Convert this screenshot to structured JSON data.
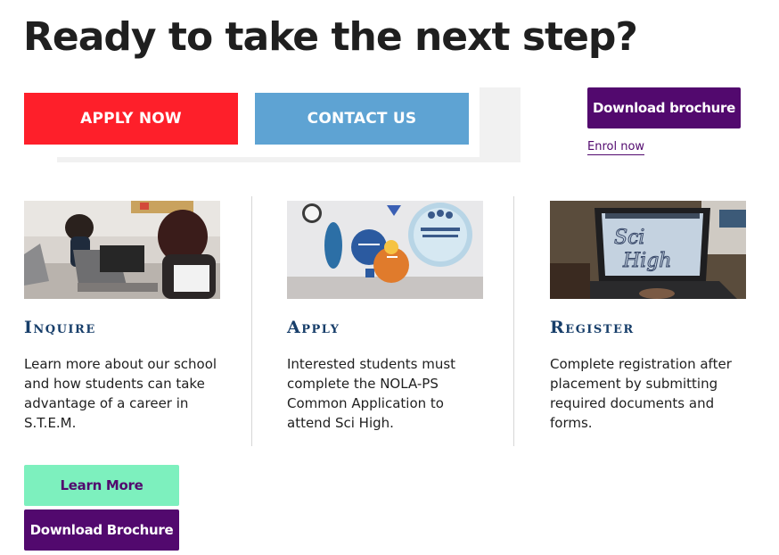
{
  "hero": {
    "headline": "Ready to take the next step?"
  },
  "cta": {
    "apply_label": "APPLY NOW",
    "apply_color": "#fe1f2a",
    "contact_label": "CONTACT US",
    "contact_color": "#5ea3d3",
    "download_label": "Download brochure",
    "enrol_label": "Enrol now"
  },
  "cards": [
    {
      "title": "Inquire",
      "text": "Learn more about our school and how students can take advantage of a career in S.T.E.M.",
      "image": "students-with-laptops-photo"
    },
    {
      "title": "Apply",
      "text": "Interested students must complete the NOLA-PS Common Application to attend Sci High.",
      "image": "values-wall-signs-photo"
    },
    {
      "title": "Register",
      "text": "Complete registration after placement by submitting required documents and forms.",
      "image": "laptop-sci-high-design-photo"
    }
  ],
  "footer_buttons": {
    "learn_more_label": "Learn More",
    "learn_more_color": "#7df0be",
    "download_label": "Download Brochure",
    "brand_purple": "#52096e"
  }
}
